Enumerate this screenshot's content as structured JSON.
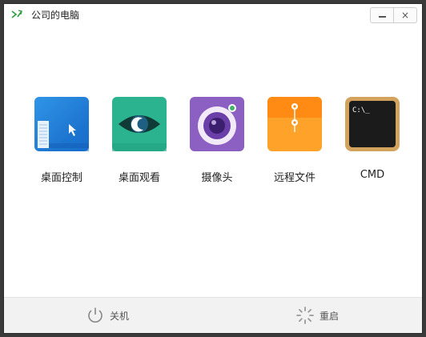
{
  "window": {
    "title": "公司的电脑",
    "minimize_glyph": "",
    "close_glyph": "×"
  },
  "tiles": [
    {
      "label": "桌面控制",
      "icon": "desktop-control-icon"
    },
    {
      "label": "桌面观看",
      "icon": "eye-icon"
    },
    {
      "label": "摄像头",
      "icon": "camera-icon"
    },
    {
      "label": "远程文件",
      "icon": "folder-icon"
    },
    {
      "label": "CMD",
      "icon": "terminal-icon",
      "terminal_text": "C:\\_"
    }
  ],
  "footer": {
    "shutdown_label": "关机",
    "restart_label": "重启"
  },
  "colors": {
    "desktop_blue": "#1e7fd6",
    "eye_teal": "#2bb38f",
    "camera_purple": "#8c5fc2",
    "folder_orange": "#ffa22a",
    "cmd_gold": "#d3a35d",
    "app_green": "#2e9e3a"
  }
}
